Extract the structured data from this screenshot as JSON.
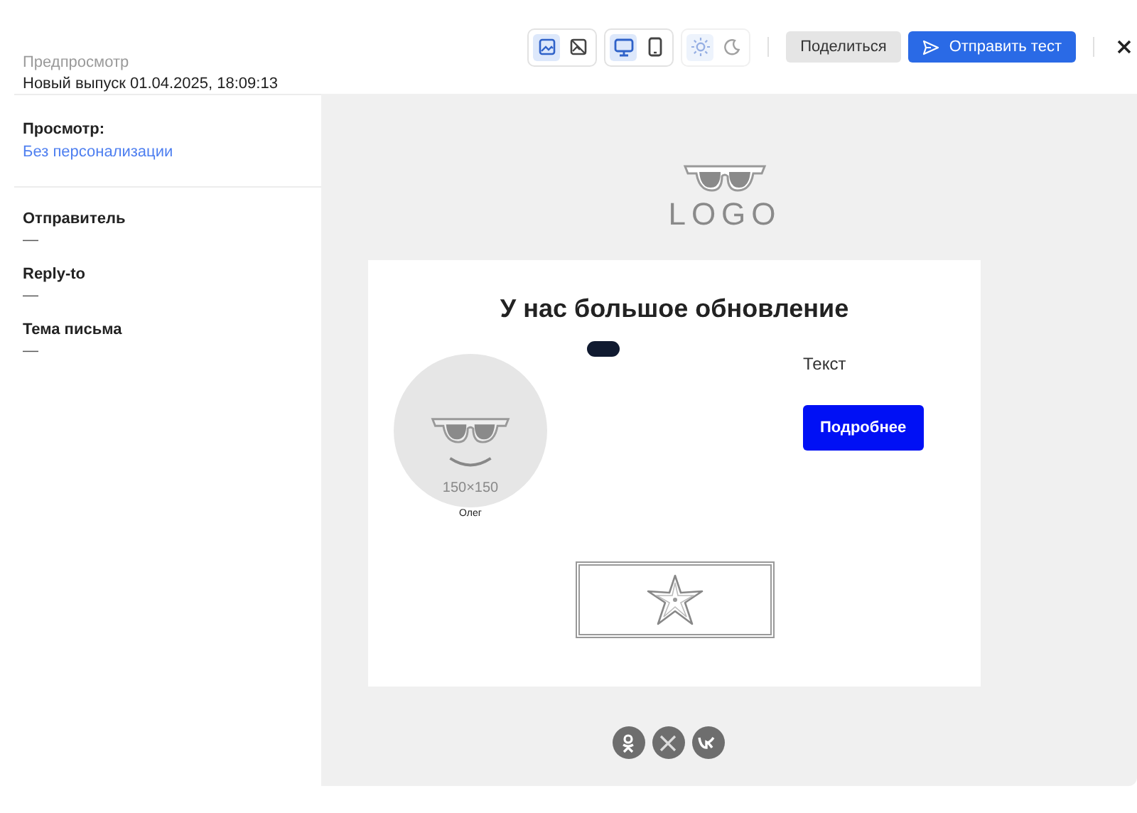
{
  "header": {
    "subtitle": "Предпросмотр",
    "title": "Новый выпуск 01.04.2025, 18:09:13"
  },
  "view": {
    "label": "Просмотр:",
    "value": "Без персонализации"
  },
  "fields": [
    {
      "label": "Отправитель",
      "value": "—"
    },
    {
      "label": "Reply-to",
      "value": "—"
    },
    {
      "label": "Тема письма",
      "value": "—"
    }
  ],
  "toolbar": {
    "groups": [
      {
        "disabled": false,
        "items": [
          {
            "kind": "images-on",
            "selected": true
          },
          {
            "kind": "images-off",
            "selected": false
          }
        ]
      },
      {
        "disabled": false,
        "items": [
          {
            "kind": "desktop",
            "selected": true
          },
          {
            "kind": "mobile",
            "selected": false
          }
        ]
      },
      {
        "disabled": true,
        "items": [
          {
            "kind": "light",
            "selected": true
          },
          {
            "kind": "dark",
            "selected": false
          }
        ]
      }
    ],
    "share": "Поделиться",
    "send": "Отправить тест"
  },
  "email": {
    "logo_text": "LOGO",
    "heading": "У нас большое обновление",
    "avatar_caption": "150×150",
    "avatar_name": "Олег",
    "text": "Текст",
    "button": "Подробнее",
    "socials": [
      {
        "kind": "ok"
      },
      {
        "kind": "x"
      },
      {
        "kind": "vk"
      }
    ]
  }
}
